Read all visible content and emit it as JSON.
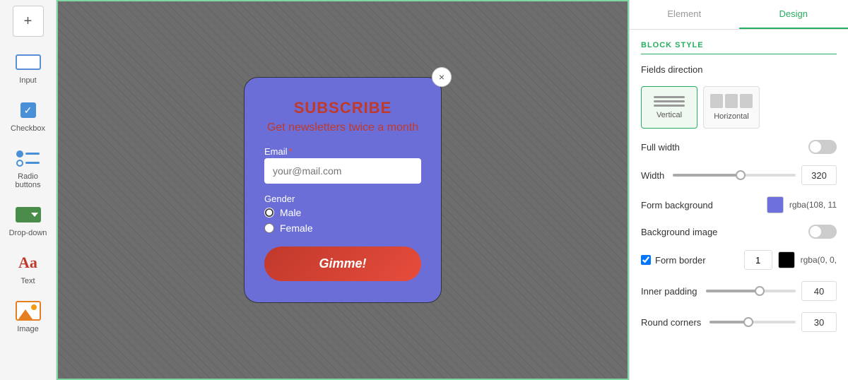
{
  "leftSidebar": {
    "addButton": "+",
    "items": [
      {
        "id": "input",
        "label": "Input"
      },
      {
        "id": "checkbox",
        "label": "Checkbox"
      },
      {
        "id": "radio-buttons",
        "label": "Radio buttons"
      },
      {
        "id": "drop-down",
        "label": "Drop-down"
      },
      {
        "id": "text",
        "label": "Text"
      },
      {
        "id": "image",
        "label": "Image"
      }
    ]
  },
  "formCard": {
    "title": "SUBSCRIBE",
    "subtitle": "Get newsletters twice a month",
    "emailLabel": "Email",
    "emailPlaceholder": "your@mail.com",
    "genderLabel": "Gender",
    "radioOptions": [
      {
        "value": "male",
        "label": "Male",
        "checked": true
      },
      {
        "value": "female",
        "label": "Female",
        "checked": false
      }
    ],
    "submitButton": "Gimme!",
    "closeButton": "×"
  },
  "rightPanel": {
    "tabs": [
      {
        "id": "element",
        "label": "Element",
        "active": false
      },
      {
        "id": "design",
        "label": "Design",
        "active": true
      }
    ],
    "blockStyle": {
      "sectionTitle": "BLOCK STYLE",
      "fieldsDirection": {
        "label": "Fields direction",
        "options": [
          {
            "id": "vertical",
            "label": "Vertical",
            "selected": true
          },
          {
            "id": "horizontal",
            "label": "Horizontal",
            "selected": false
          }
        ]
      },
      "fullWidth": {
        "label": "Full width",
        "enabled": false
      },
      "width": {
        "label": "Width",
        "value": "320",
        "sliderPercent": 55
      },
      "formBackground": {
        "label": "Form background",
        "color": "#6c6fdc",
        "colorText": "rgba(108, 11"
      },
      "backgroundImage": {
        "label": "Background image",
        "enabled": false
      },
      "formBorder": {
        "label": "Form border",
        "checked": true,
        "width": "1",
        "color": "#000000",
        "colorText": "rgba(0, 0,"
      },
      "innerPadding": {
        "label": "Inner padding",
        "value": "40",
        "sliderPercent": 60
      },
      "roundCorners": {
        "label": "Round corners",
        "value": "30",
        "sliderPercent": 45
      }
    }
  }
}
